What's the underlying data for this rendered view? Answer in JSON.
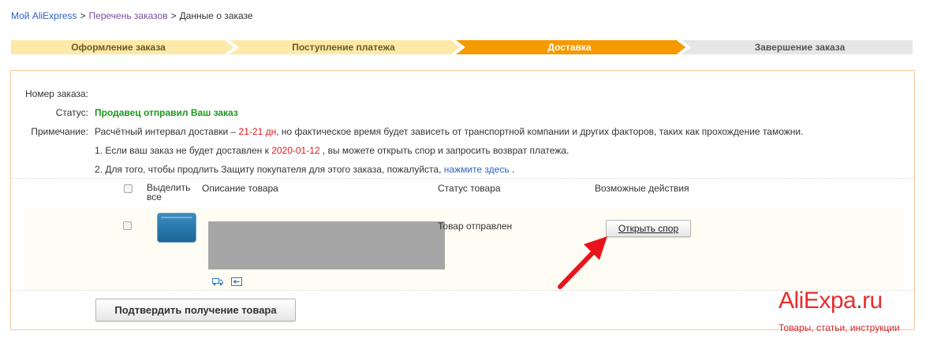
{
  "breadcrumb": {
    "home": "Мой AliExpress",
    "orders": "Перечень заказов",
    "current": "Данные о заказе",
    "separator": ">"
  },
  "steps": [
    {
      "label": "Оформление заказа",
      "state": "done"
    },
    {
      "label": "Поступление платежа",
      "state": "done"
    },
    {
      "label": "Доставка",
      "state": "active"
    },
    {
      "label": "Завершение заказа",
      "state": "pending"
    }
  ],
  "colors": {
    "step_done": "#fde9a8",
    "step_active": "#f59a00",
    "step_pending": "#e6e6e6",
    "status_green": "#1a9a1a",
    "accent_red": "#e3181b",
    "link_blue": "#2f61c5"
  },
  "order": {
    "number_label": "Номер заказа:",
    "number_value": "",
    "status_label": "Статус:",
    "status_value": "Продавец отправил Ваш заказ",
    "note_label": "Примечание:",
    "note_prefix": "Расчётный интервал доставки –",
    "note_days": "21-21 дн",
    "note_suffix": ", но фактическое время будет зависеть от транспортной компании и других факторов, таких как прохождение таможни.",
    "line1_prefix": "1. Если ваш заказ не будет доставлен к",
    "line1_date": "2020-01-12",
    "line1_suffix": ", вы можете открыть спор и запросить возврат платежа.",
    "line2_prefix": "2. Для того, чтобы продлить Защиту покупателя для этого заказа, пожалуйста,",
    "line2_link": "нажмите здесь",
    "line2_suffix": "."
  },
  "table": {
    "col_select_line1": "Выделить",
    "col_select_line2": "все",
    "col_description": "Описание товара",
    "col_status": "Статус товара",
    "col_actions": "Возможные действия",
    "items": [
      {
        "status": "Товар отправлен",
        "action": "Открыть спор"
      }
    ]
  },
  "icons": {
    "shipping": "truck-icon",
    "return": "return-icon",
    "arrow": "red-arrow-icon"
  },
  "confirm_button": "Подтвердить получение товара",
  "watermark": {
    "logo_main": "AliExpa",
    "logo_dot": ".",
    "logo_tld": "ru",
    "tagline": "Товары, статьи, инструкции"
  }
}
